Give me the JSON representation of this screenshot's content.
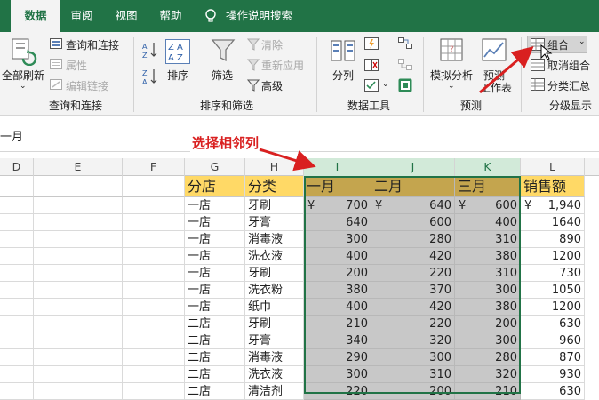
{
  "tabs": [
    "数据",
    "审阅",
    "视图",
    "帮助",
    "操作说明搜索"
  ],
  "ribbon": {
    "refresh_all": "全部刷新",
    "queries_connections": "查询和连接",
    "properties": "属性",
    "edit_links": "编辑链接",
    "group_queries": "查询和连接",
    "sort": "排序",
    "filter": "筛选",
    "clear": "清除",
    "reapply": "重新应用",
    "advanced": "高级",
    "group_sort_filter": "排序和筛选",
    "text_to_columns": "分列",
    "group_data_tools": "数据工具",
    "what_if": "模拟分析",
    "forecast_sheet_line1": "预测",
    "forecast_sheet_line2": "工作表",
    "group_forecast": "预测",
    "group_btn": "组合",
    "ungroup_btn": "取消组合",
    "subtotal": "分类汇总",
    "group_outline": "分级显示"
  },
  "formula_bar": {
    "value": "一月"
  },
  "annotation": "选择相邻列",
  "columns": [
    "D",
    "E",
    "F",
    "G",
    "H",
    "I",
    "J",
    "K",
    "L"
  ],
  "table": {
    "headers": [
      "分店",
      "分类",
      "一月",
      "二月",
      "三月",
      "销售额"
    ],
    "rows": [
      {
        "store": "一店",
        "cat": "牙刷",
        "jan_cur": "¥",
        "jan": "700",
        "feb_cur": "¥",
        "feb": "640",
        "mar_cur": "¥",
        "mar": "600",
        "sales_cur": "¥",
        "sales": "1,940"
      },
      {
        "store": "一店",
        "cat": "牙膏",
        "jan": "640",
        "feb": "600",
        "mar": "400",
        "sales": "1640"
      },
      {
        "store": "一店",
        "cat": "消毒液",
        "jan": "300",
        "feb": "280",
        "mar": "310",
        "sales": "890"
      },
      {
        "store": "一店",
        "cat": "洗衣液",
        "jan": "400",
        "feb": "420",
        "mar": "380",
        "sales": "1200"
      },
      {
        "store": "一店",
        "cat": "牙刷",
        "jan": "200",
        "feb": "220",
        "mar": "310",
        "sales": "730"
      },
      {
        "store": "一店",
        "cat": "洗衣粉",
        "jan": "380",
        "feb": "370",
        "mar": "300",
        "sales": "1050"
      },
      {
        "store": "一店",
        "cat": "纸巾",
        "jan": "400",
        "feb": "420",
        "mar": "380",
        "sales": "1200"
      },
      {
        "store": "二店",
        "cat": "牙刷",
        "jan": "210",
        "feb": "220",
        "mar": "200",
        "sales": "630"
      },
      {
        "store": "二店",
        "cat": "牙膏",
        "jan": "340",
        "feb": "320",
        "mar": "300",
        "sales": "960"
      },
      {
        "store": "二店",
        "cat": "消毒液",
        "jan": "290",
        "feb": "300",
        "mar": "280",
        "sales": "870"
      },
      {
        "store": "二店",
        "cat": "洗衣液",
        "jan": "300",
        "feb": "310",
        "mar": "320",
        "sales": "930"
      },
      {
        "store": "二店",
        "cat": "清洁剂",
        "jan": "220",
        "feb": "200",
        "mar": "210",
        "sales": "630"
      }
    ]
  },
  "colors": {
    "accent": "#217346",
    "header_fill": "#ffd966",
    "selection": "#c8c8c8",
    "annotation": "#d92020"
  }
}
